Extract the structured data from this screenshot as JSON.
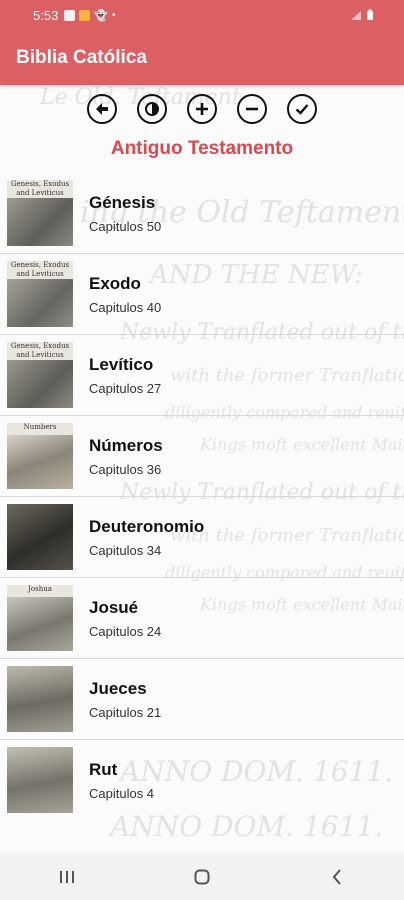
{
  "status_bar": {
    "time": "5:53",
    "icons": [
      "notification-icon",
      "message-icon",
      "snapchat-icon",
      "dot-icon"
    ],
    "right_icons": [
      "signal-icon",
      "battery-icon"
    ]
  },
  "app_bar": {
    "title": "Biblia Católica"
  },
  "toolbar": {
    "buttons": [
      "back-icon",
      "contrast-icon",
      "plus-icon",
      "minus-icon",
      "check-icon"
    ]
  },
  "section": {
    "title": "Antiguo Testamento"
  },
  "books": [
    {
      "name": "Génesis",
      "chapters": "Capitulos 50",
      "thumb_caption": "Genesis, Exodus and Leviticus"
    },
    {
      "name": "Exodo",
      "chapters": "Capitulos 40",
      "thumb_caption": "Genesis, Exodus and Leviticus"
    },
    {
      "name": "Levítico",
      "chapters": "Capitulos 27",
      "thumb_caption": "Genesis, Exodus and Leviticus"
    },
    {
      "name": "Números",
      "chapters": "Capitulos 36",
      "thumb_caption": "Numbers"
    },
    {
      "name": "Deuteronomio",
      "chapters": "Capitulos 34",
      "thumb_caption": ""
    },
    {
      "name": "Josué",
      "chapters": "Capitulos 24",
      "thumb_caption": "Joshua"
    },
    {
      "name": "Jueces",
      "chapters": "Capitulos 21",
      "thumb_caption": ""
    },
    {
      "name": "Rut",
      "chapters": "Capitulos 4",
      "thumb_caption": ""
    }
  ],
  "colors": {
    "accent": "#dc5f63",
    "section_title": "#d64a50"
  }
}
